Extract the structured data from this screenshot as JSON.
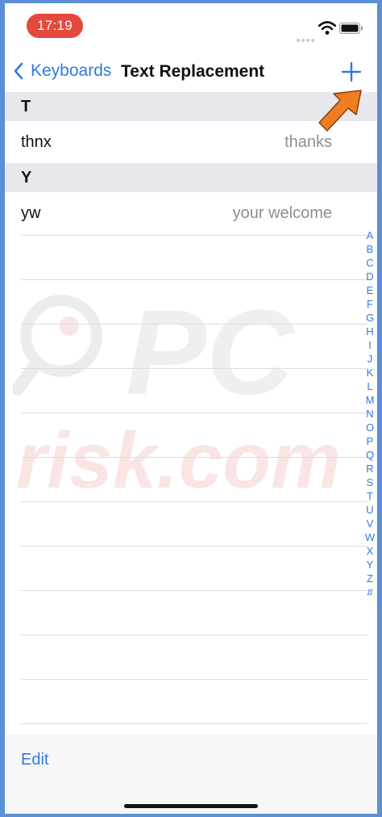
{
  "status_bar": {
    "time": "17:19"
  },
  "nav": {
    "back_label": "Keyboards",
    "title": "Text Replacement"
  },
  "sections": [
    {
      "letter": "T",
      "items": [
        {
          "phrase": "thnx",
          "shortcut": "thanks"
        }
      ]
    },
    {
      "letter": "Y",
      "items": [
        {
          "phrase": "yw",
          "shortcut": "your welcome"
        }
      ]
    }
  ],
  "index_letters": [
    "A",
    "B",
    "C",
    "D",
    "E",
    "F",
    "G",
    "H",
    "I",
    "J",
    "K",
    "L",
    "M",
    "N",
    "O",
    "P",
    "Q",
    "R",
    "S",
    "T",
    "U",
    "V",
    "W",
    "X",
    "Y",
    "Z",
    "#"
  ],
  "toolbar": {
    "edit_label": "Edit"
  },
  "watermark": {
    "line1": "PC",
    "line2": "risk.com"
  },
  "colors": {
    "accent": "#2f7ae0",
    "time_pill": "#e5483c",
    "annotation_arrow": "#ef7d22",
    "page_frame": "#5b8fd6"
  },
  "icons": {
    "back": "chevron-left-icon",
    "add": "plus-icon",
    "wifi": "wifi-icon",
    "battery": "battery-icon"
  }
}
